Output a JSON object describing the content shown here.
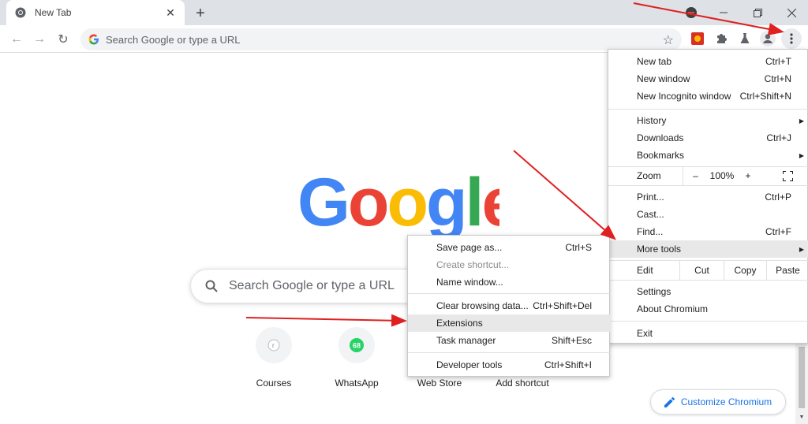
{
  "colors": {
    "accent": "#1a73e8",
    "annotation_arrow": "#e02020",
    "google_blue": "#4285f4",
    "google_red": "#ea4335",
    "google_yellow": "#fbbc05",
    "google_green": "#34a853"
  },
  "tab": {
    "title": "New Tab",
    "favicon": "chromium-icon",
    "close_icon": "close-icon"
  },
  "toolbar": {
    "omnibox_placeholder": "Search Google or type a URL",
    "extension_icons": [
      "extension-red-icon",
      "puzzle-icon",
      "flask-icon",
      "profile-icon"
    ]
  },
  "ntp": {
    "logo_text": "Google",
    "search_placeholder": "Search Google or type a URL",
    "shortcuts": [
      {
        "label": "Courses",
        "icon": "courses-icon"
      },
      {
        "label": "WhatsApp",
        "icon": "whatsapp-icon",
        "badge": "68"
      },
      {
        "label": "Web Store",
        "icon": "webstore-icon"
      },
      {
        "label": "Add shortcut",
        "icon": "plus-icon"
      }
    ],
    "customize_label": "Customize Chromium"
  },
  "main_menu": {
    "new_tab": {
      "label": "New tab",
      "shortcut": "Ctrl+T"
    },
    "new_window": {
      "label": "New window",
      "shortcut": "Ctrl+N"
    },
    "new_incognito": {
      "label": "New Incognito window",
      "shortcut": "Ctrl+Shift+N"
    },
    "history": {
      "label": "History"
    },
    "downloads": {
      "label": "Downloads",
      "shortcut": "Ctrl+J"
    },
    "bookmarks": {
      "label": "Bookmarks"
    },
    "zoom": {
      "label": "Zoom",
      "minus": "–",
      "value": "100%",
      "plus": "+"
    },
    "print": {
      "label": "Print...",
      "shortcut": "Ctrl+P"
    },
    "cast": {
      "label": "Cast..."
    },
    "find": {
      "label": "Find...",
      "shortcut": "Ctrl+F"
    },
    "more_tools": {
      "label": "More tools"
    },
    "edit": {
      "label": "Edit",
      "cut": "Cut",
      "copy": "Copy",
      "paste": "Paste"
    },
    "settings": {
      "label": "Settings"
    },
    "about": {
      "label": "About Chromium"
    },
    "exit": {
      "label": "Exit"
    }
  },
  "sub_menu": {
    "save_page": {
      "label": "Save page as...",
      "shortcut": "Ctrl+S"
    },
    "create_shortcut": {
      "label": "Create shortcut..."
    },
    "name_window": {
      "label": "Name window..."
    },
    "clear_data": {
      "label": "Clear browsing data...",
      "shortcut": "Ctrl+Shift+Del"
    },
    "extensions": {
      "label": "Extensions"
    },
    "task_manager": {
      "label": "Task manager",
      "shortcut": "Shift+Esc"
    },
    "dev_tools": {
      "label": "Developer tools",
      "shortcut": "Ctrl+Shift+I"
    }
  }
}
